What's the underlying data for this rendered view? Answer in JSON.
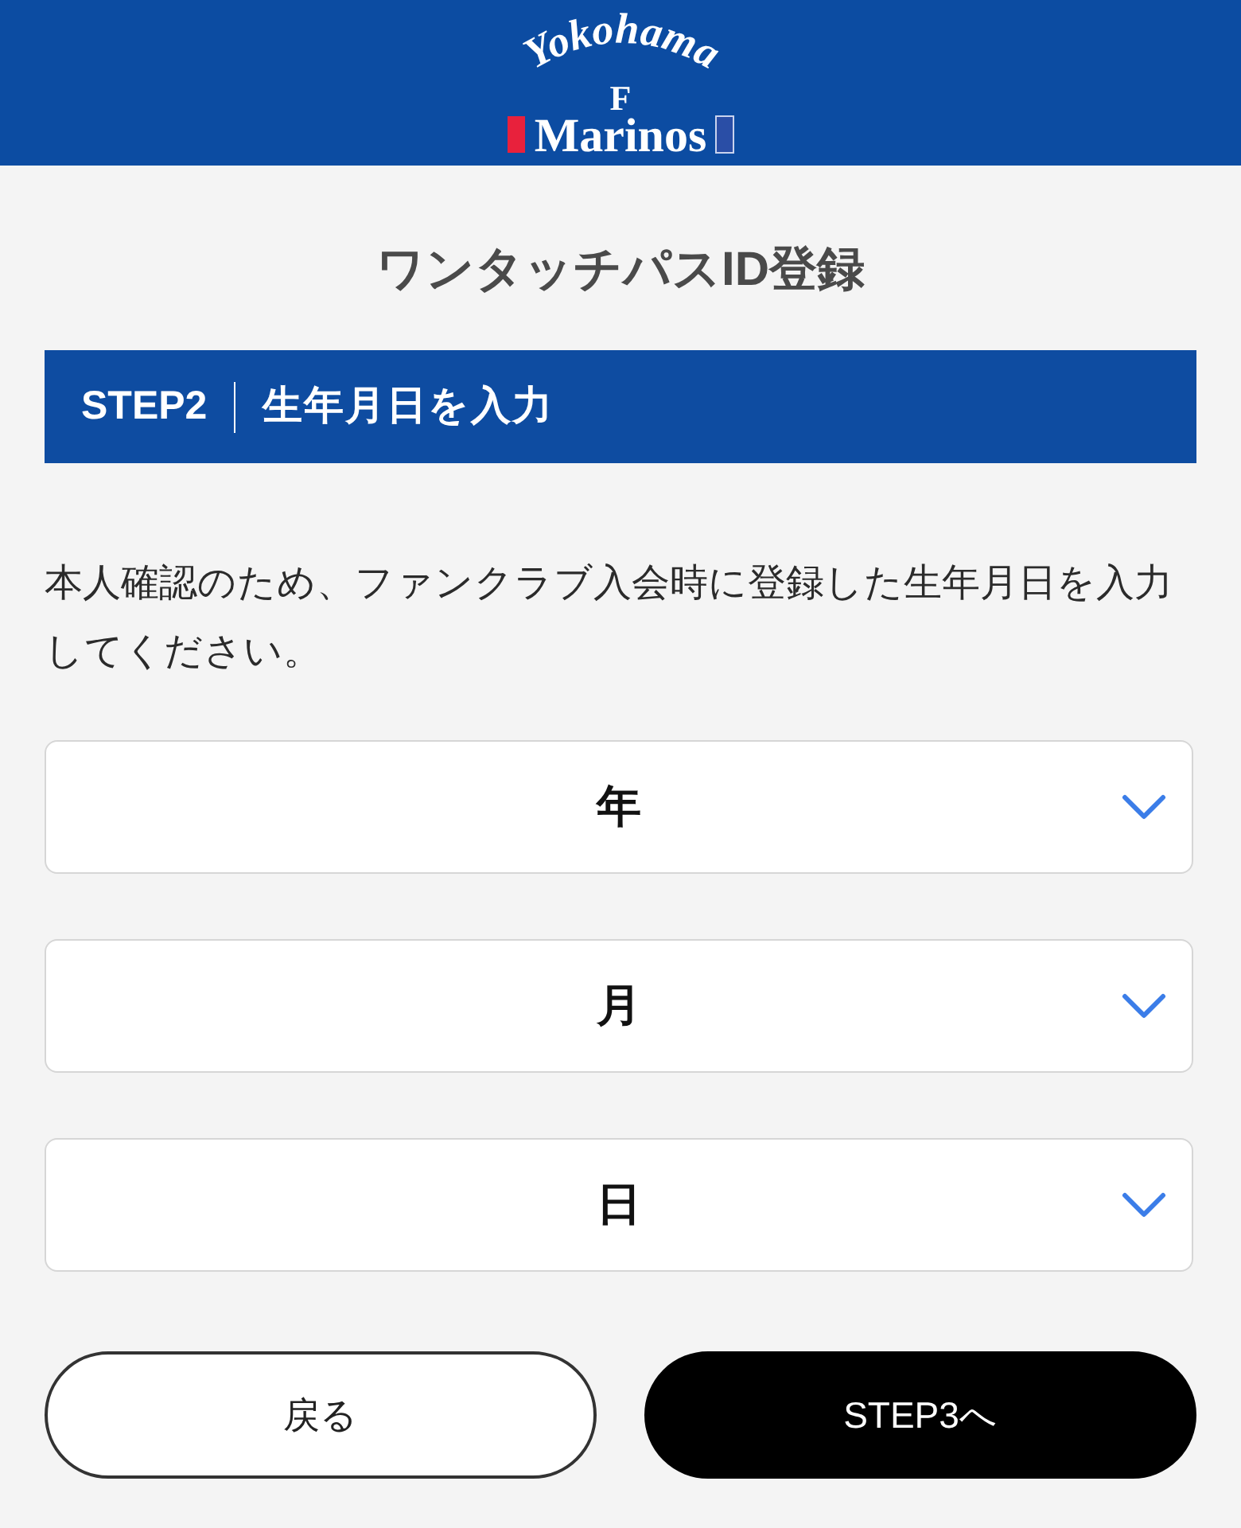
{
  "header": {
    "logo": {
      "line_1": "Yokohama",
      "line_2": "F",
      "line_3": "Marinos"
    }
  },
  "page_title": "ワンタッチパスID登録",
  "step_banner": {
    "step": "STEP2",
    "title": "生年月日を入力"
  },
  "instructions": "本人確認のため、ファンクラブ入会時に登録した生年月日を入力してください。",
  "date_selects": [
    {
      "placeholder": "年"
    },
    {
      "placeholder": "月"
    },
    {
      "placeholder": "日"
    }
  ],
  "buttons": [
    {
      "label": "戻る",
      "kind": "secondary"
    },
    {
      "label": "STEP3へ",
      "kind": "primary"
    }
  ]
}
